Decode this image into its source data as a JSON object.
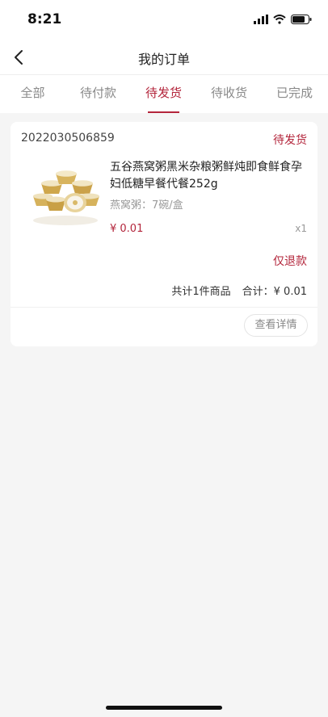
{
  "status_bar": {
    "time": "8:21"
  },
  "nav": {
    "title": "我的订单"
  },
  "tabs": [
    {
      "label": "全部"
    },
    {
      "label": "待付款"
    },
    {
      "label": "待发货"
    },
    {
      "label": "待收货"
    },
    {
      "label": "已完成"
    }
  ],
  "order": {
    "number": "2022030506859",
    "status": "待发货",
    "product": {
      "title": "五谷燕窝粥黑米杂粮粥鲜炖即食鲜食孕妇低糖早餐代餐252g",
      "spec": "燕窝粥：7碗/盒",
      "price": "¥ 0.01",
      "quantity": "x1"
    },
    "refund_label": "仅退款",
    "summary_count": "共计1件商品",
    "summary_total": "合计：¥ 0.01",
    "detail_button": "查看详情"
  },
  "colors": {
    "accent": "#b3253b",
    "background": "#f5f5f5"
  },
  "icons": [
    "signal-icon",
    "wifi-icon",
    "battery-icon",
    "back-chevron-icon"
  ]
}
